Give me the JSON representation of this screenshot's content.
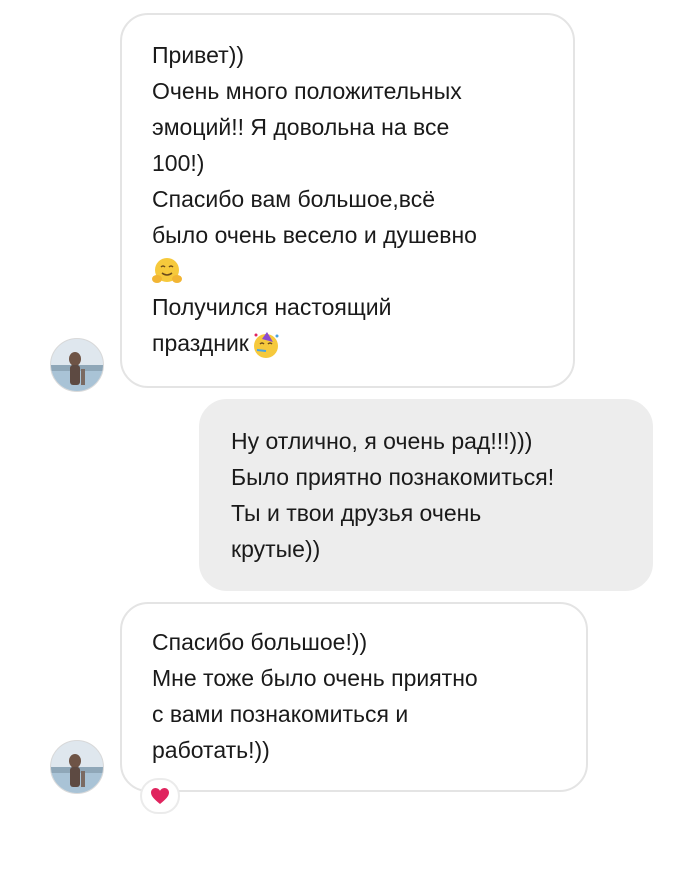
{
  "chat": {
    "messages": [
      {
        "direction": "incoming",
        "lines": [
          "Привет))",
          "Очень много положительных",
          "эмоций!! Я довольна на все",
          "100!)",
          "Спасибо вам большое,всё",
          "было очень весело и душевно",
          "Получился настоящий",
          "праздник"
        ],
        "emojis": [
          "hugging-face-emoji",
          "partying-face-emoji"
        ]
      },
      {
        "direction": "outgoing",
        "lines": [
          "Ну отлично, я очень рад!!!)))",
          "Было приятно познакомиться!",
          "Ты и твои друзья очень",
          "крутые))"
        ]
      },
      {
        "direction": "incoming",
        "lines": [
          "Спасибо большое!))",
          "Мне тоже было очень приятно",
          "с вами познакомиться и",
          "работать!))"
        ],
        "reaction": "heart-icon"
      }
    ]
  },
  "colors": {
    "incoming_bg": "#ffffff",
    "incoming_border": "#e4e4e4",
    "outgoing_bg": "#ededed",
    "text": "#1a1a1a",
    "heart": "#e0245e",
    "emoji_yellow": "#f6c93c"
  }
}
